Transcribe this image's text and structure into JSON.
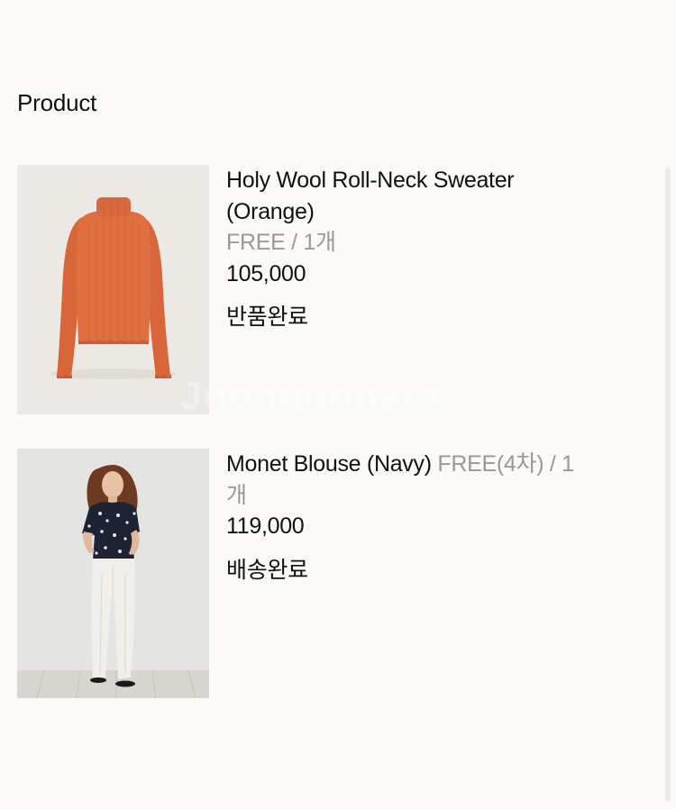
{
  "section": {
    "title": "Product"
  },
  "products": [
    {
      "name": "Holy Wool Roll-Neck Sweater (Orange)",
      "option": "FREE / 1개",
      "price": "105,000",
      "status": "반품완료",
      "image": "orange-roll-neck-sweater"
    },
    {
      "name": "Monet Blouse (Navy)",
      "option": "FREE(4차) / 1개",
      "price": "119,000",
      "status": "배송완료",
      "image": "model-navy-blouse-white-pants"
    }
  ],
  "watermark": "Joonggonara"
}
